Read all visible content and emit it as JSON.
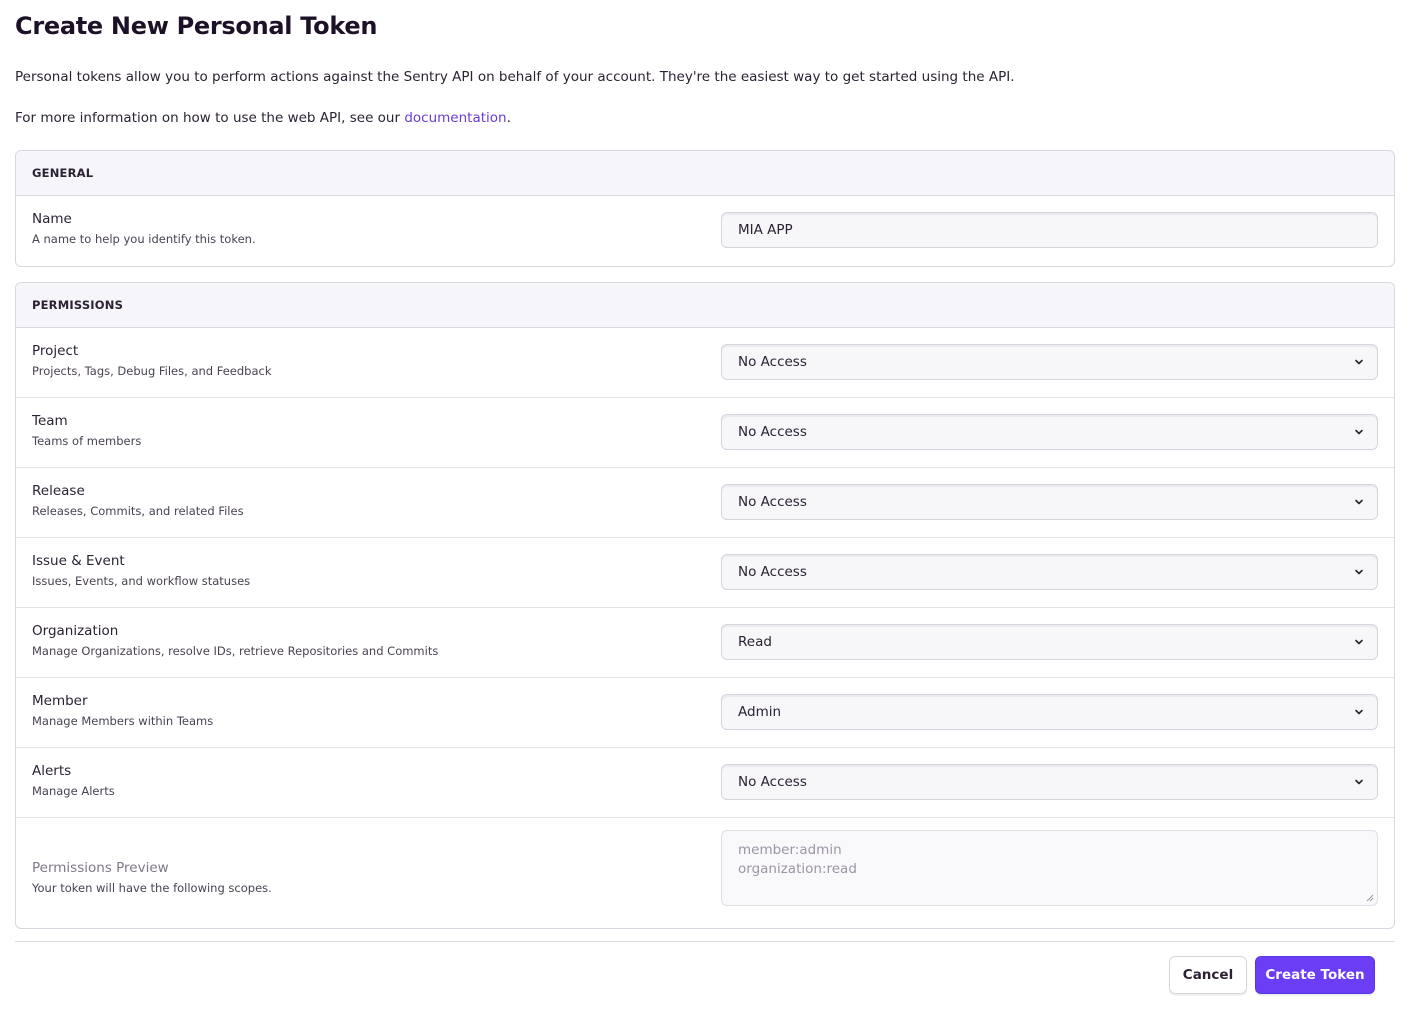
{
  "page": {
    "title": "Create New Personal Token",
    "intro_text": "Personal tokens allow you to perform actions against the Sentry API on behalf of your account. They're the easiest way to get started using the API.",
    "info_prefix": "For more information on how to use the web API, see our ",
    "info_link": "documentation",
    "info_suffix": "."
  },
  "general": {
    "header": "GENERAL",
    "name_label": "Name",
    "name_help": "A name to help you identify this token.",
    "name_value": "MIA APP"
  },
  "permissions": {
    "header": "PERMISSIONS",
    "rows": [
      {
        "label": "Project",
        "help": "Projects, Tags, Debug Files, and Feedback",
        "value": "No Access"
      },
      {
        "label": "Team",
        "help": "Teams of members",
        "value": "No Access"
      },
      {
        "label": "Release",
        "help": "Releases, Commits, and related Files",
        "value": "No Access"
      },
      {
        "label": "Issue & Event",
        "help": "Issues, Events, and workflow statuses",
        "value": "No Access"
      },
      {
        "label": "Organization",
        "help": "Manage Organizations, resolve IDs, retrieve Repositories and Commits",
        "value": "Read"
      },
      {
        "label": "Member",
        "help": "Manage Members within Teams",
        "value": "Admin"
      },
      {
        "label": "Alerts",
        "help": "Manage Alerts",
        "value": "No Access"
      }
    ],
    "preview_label": "Permissions Preview",
    "preview_help": "Your token will have the following scopes.",
    "preview_scopes": [
      "member:admin",
      "organization:read"
    ]
  },
  "actions": {
    "cancel_label": "Cancel",
    "create_label": "Create Token"
  },
  "icons": {
    "select_chevron": "chevron-down-icon",
    "resize_handle": "resize-handle-icon"
  },
  "colors": {
    "accent": "#6b3df5",
    "link": "#6a3cd9"
  }
}
